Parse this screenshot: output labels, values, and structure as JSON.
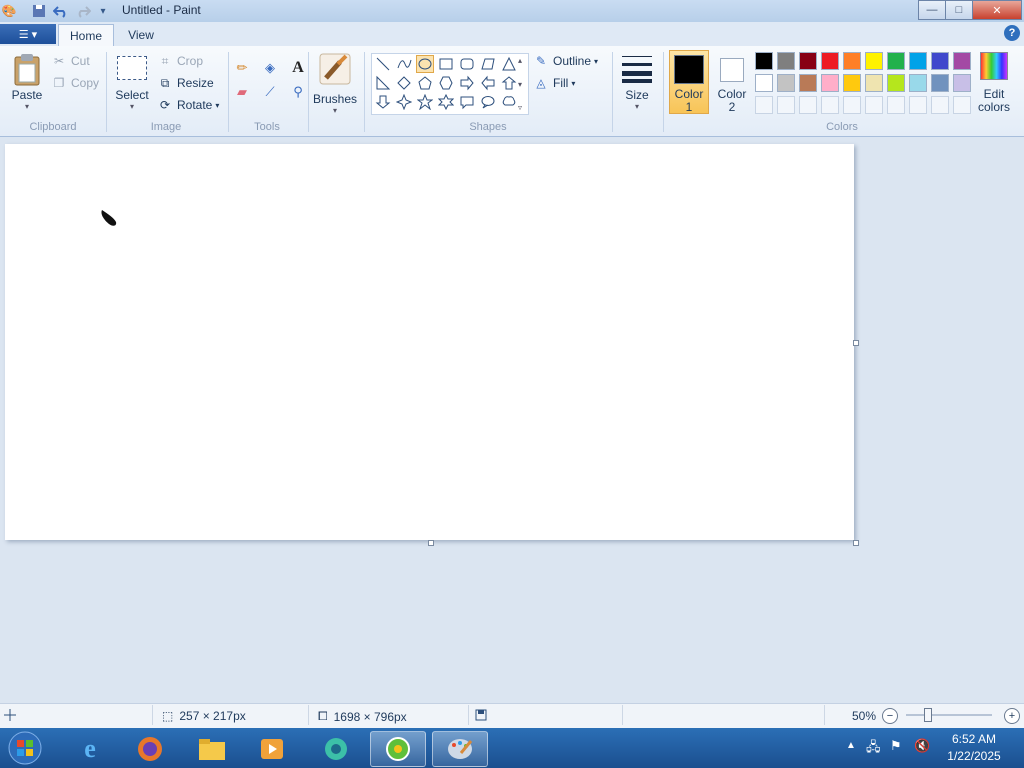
{
  "window": {
    "title": "Untitled - Paint",
    "minimize": "—",
    "maximize": "□",
    "close": "✕"
  },
  "tabs": {
    "file": "☰ ▾",
    "home": "Home",
    "view": "View",
    "help": "?"
  },
  "clipboard": {
    "paste": "Paste",
    "cut": "Cut",
    "copy": "Copy",
    "group": "Clipboard"
  },
  "image": {
    "select": "Select",
    "crop": "Crop",
    "resize": "Resize",
    "rotate": "Rotate",
    "group": "Image"
  },
  "tools": {
    "group": "Tools",
    "text_tool": "A"
  },
  "brushes": {
    "label": "Brushes"
  },
  "shapes": {
    "group": "Shapes",
    "outline": "Outline",
    "fill": "Fill"
  },
  "size": {
    "label": "Size"
  },
  "colors": {
    "color1_line1": "Color",
    "color1_line2": "1",
    "color2_line1": "Color",
    "color2_line2": "2",
    "edit_line1": "Edit",
    "edit_line2": "colors",
    "group": "Colors",
    "color1_value": "#000000",
    "color2_value": "#ffffff",
    "palette_row1": [
      "#000000",
      "#7f7f7f",
      "#880015",
      "#ed1c24",
      "#ff7f27",
      "#fff200",
      "#22b14c",
      "#00a2e8",
      "#3f48cc",
      "#a349a4"
    ],
    "palette_row2": [
      "#ffffff",
      "#c3c3c3",
      "#b97a57",
      "#ffaec9",
      "#ffc90e",
      "#efe4b0",
      "#b5e61d",
      "#99d9ea",
      "#7092be",
      "#c8bfe7"
    ]
  },
  "status": {
    "cursor_pos": "257 × 217px",
    "canvas_size": "1698 × 796px",
    "zoom": "50%"
  },
  "taskbar": {
    "time": "6:52 AM",
    "date": "1/22/2025"
  }
}
